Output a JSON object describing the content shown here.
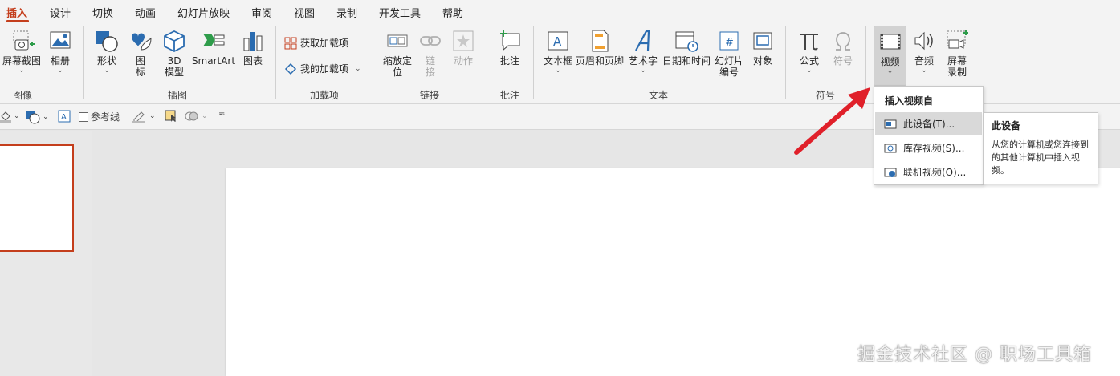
{
  "tabs": [
    "插入",
    "设计",
    "切换",
    "动画",
    "幻灯片放映",
    "审阅",
    "视图",
    "录制",
    "开发工具",
    "帮助"
  ],
  "ribbon": {
    "screenshot": "屏幕截图",
    "album": "相册",
    "group_images": "图像",
    "shapes": "形状",
    "icons": [
      "图",
      "标"
    ],
    "model3d": [
      "3D",
      "模型"
    ],
    "smartart": "SmartArt",
    "chart": "图表",
    "group_illustrations": "插图",
    "get_addins": "获取加载项",
    "my_addins": "我的加载项",
    "group_addins": "加载项",
    "zoom": [
      "缩放定",
      "位"
    ],
    "link": [
      "链",
      "接"
    ],
    "action": "动作",
    "group_links": "链接",
    "comment": "批注",
    "group_comments": "批注",
    "textbox": "文本框",
    "header_footer": "页眉和页脚",
    "wordart": "艺术字",
    "datetime": "日期和时间",
    "slide_number": [
      "幻灯片",
      "编号"
    ],
    "object": "对象",
    "group_text": "文本",
    "equation": "公式",
    "symbol": "符号",
    "group_symbols": "符号",
    "video": "视频",
    "audio": "音频",
    "screen_recording": [
      "屏幕",
      "录制"
    ]
  },
  "qat": {
    "guides": "参考线"
  },
  "video_menu": {
    "title": "插入视频自",
    "items": [
      "此设备(T)...",
      "库存视频(S)...",
      "联机视频(O)..."
    ]
  },
  "tooltip": {
    "title": "此设备",
    "body": "从您的计算机或您连接到的其他计算机中插入视频。"
  },
  "watermark": "掘金技术社区 @ 职场工具箱",
  "colors": {
    "accent": "#c43e1c",
    "arrow": "#e0202a",
    "icon_blue": "#2b6cb0"
  }
}
